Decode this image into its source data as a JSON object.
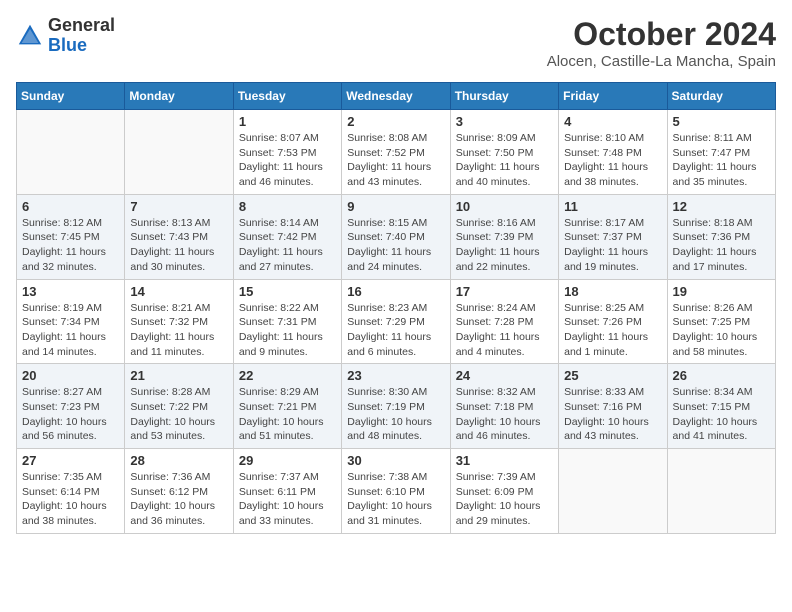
{
  "header": {
    "logo_general": "General",
    "logo_blue": "Blue",
    "month_title": "October 2024",
    "location": "Alocen, Castille-La Mancha, Spain"
  },
  "days_of_week": [
    "Sunday",
    "Monday",
    "Tuesday",
    "Wednesday",
    "Thursday",
    "Friday",
    "Saturday"
  ],
  "weeks": [
    [
      {
        "day": "",
        "info": ""
      },
      {
        "day": "",
        "info": ""
      },
      {
        "day": "1",
        "info": "Sunrise: 8:07 AM\nSunset: 7:53 PM\nDaylight: 11 hours and 46 minutes."
      },
      {
        "day": "2",
        "info": "Sunrise: 8:08 AM\nSunset: 7:52 PM\nDaylight: 11 hours and 43 minutes."
      },
      {
        "day": "3",
        "info": "Sunrise: 8:09 AM\nSunset: 7:50 PM\nDaylight: 11 hours and 40 minutes."
      },
      {
        "day": "4",
        "info": "Sunrise: 8:10 AM\nSunset: 7:48 PM\nDaylight: 11 hours and 38 minutes."
      },
      {
        "day": "5",
        "info": "Sunrise: 8:11 AM\nSunset: 7:47 PM\nDaylight: 11 hours and 35 minutes."
      }
    ],
    [
      {
        "day": "6",
        "info": "Sunrise: 8:12 AM\nSunset: 7:45 PM\nDaylight: 11 hours and 32 minutes."
      },
      {
        "day": "7",
        "info": "Sunrise: 8:13 AM\nSunset: 7:43 PM\nDaylight: 11 hours and 30 minutes."
      },
      {
        "day": "8",
        "info": "Sunrise: 8:14 AM\nSunset: 7:42 PM\nDaylight: 11 hours and 27 minutes."
      },
      {
        "day": "9",
        "info": "Sunrise: 8:15 AM\nSunset: 7:40 PM\nDaylight: 11 hours and 24 minutes."
      },
      {
        "day": "10",
        "info": "Sunrise: 8:16 AM\nSunset: 7:39 PM\nDaylight: 11 hours and 22 minutes."
      },
      {
        "day": "11",
        "info": "Sunrise: 8:17 AM\nSunset: 7:37 PM\nDaylight: 11 hours and 19 minutes."
      },
      {
        "day": "12",
        "info": "Sunrise: 8:18 AM\nSunset: 7:36 PM\nDaylight: 11 hours and 17 minutes."
      }
    ],
    [
      {
        "day": "13",
        "info": "Sunrise: 8:19 AM\nSunset: 7:34 PM\nDaylight: 11 hours and 14 minutes."
      },
      {
        "day": "14",
        "info": "Sunrise: 8:21 AM\nSunset: 7:32 PM\nDaylight: 11 hours and 11 minutes."
      },
      {
        "day": "15",
        "info": "Sunrise: 8:22 AM\nSunset: 7:31 PM\nDaylight: 11 hours and 9 minutes."
      },
      {
        "day": "16",
        "info": "Sunrise: 8:23 AM\nSunset: 7:29 PM\nDaylight: 11 hours and 6 minutes."
      },
      {
        "day": "17",
        "info": "Sunrise: 8:24 AM\nSunset: 7:28 PM\nDaylight: 11 hours and 4 minutes."
      },
      {
        "day": "18",
        "info": "Sunrise: 8:25 AM\nSunset: 7:26 PM\nDaylight: 11 hours and 1 minute."
      },
      {
        "day": "19",
        "info": "Sunrise: 8:26 AM\nSunset: 7:25 PM\nDaylight: 10 hours and 58 minutes."
      }
    ],
    [
      {
        "day": "20",
        "info": "Sunrise: 8:27 AM\nSunset: 7:23 PM\nDaylight: 10 hours and 56 minutes."
      },
      {
        "day": "21",
        "info": "Sunrise: 8:28 AM\nSunset: 7:22 PM\nDaylight: 10 hours and 53 minutes."
      },
      {
        "day": "22",
        "info": "Sunrise: 8:29 AM\nSunset: 7:21 PM\nDaylight: 10 hours and 51 minutes."
      },
      {
        "day": "23",
        "info": "Sunrise: 8:30 AM\nSunset: 7:19 PM\nDaylight: 10 hours and 48 minutes."
      },
      {
        "day": "24",
        "info": "Sunrise: 8:32 AM\nSunset: 7:18 PM\nDaylight: 10 hours and 46 minutes."
      },
      {
        "day": "25",
        "info": "Sunrise: 8:33 AM\nSunset: 7:16 PM\nDaylight: 10 hours and 43 minutes."
      },
      {
        "day": "26",
        "info": "Sunrise: 8:34 AM\nSunset: 7:15 PM\nDaylight: 10 hours and 41 minutes."
      }
    ],
    [
      {
        "day": "27",
        "info": "Sunrise: 7:35 AM\nSunset: 6:14 PM\nDaylight: 10 hours and 38 minutes."
      },
      {
        "day": "28",
        "info": "Sunrise: 7:36 AM\nSunset: 6:12 PM\nDaylight: 10 hours and 36 minutes."
      },
      {
        "day": "29",
        "info": "Sunrise: 7:37 AM\nSunset: 6:11 PM\nDaylight: 10 hours and 33 minutes."
      },
      {
        "day": "30",
        "info": "Sunrise: 7:38 AM\nSunset: 6:10 PM\nDaylight: 10 hours and 31 minutes."
      },
      {
        "day": "31",
        "info": "Sunrise: 7:39 AM\nSunset: 6:09 PM\nDaylight: 10 hours and 29 minutes."
      },
      {
        "day": "",
        "info": ""
      },
      {
        "day": "",
        "info": ""
      }
    ]
  ]
}
